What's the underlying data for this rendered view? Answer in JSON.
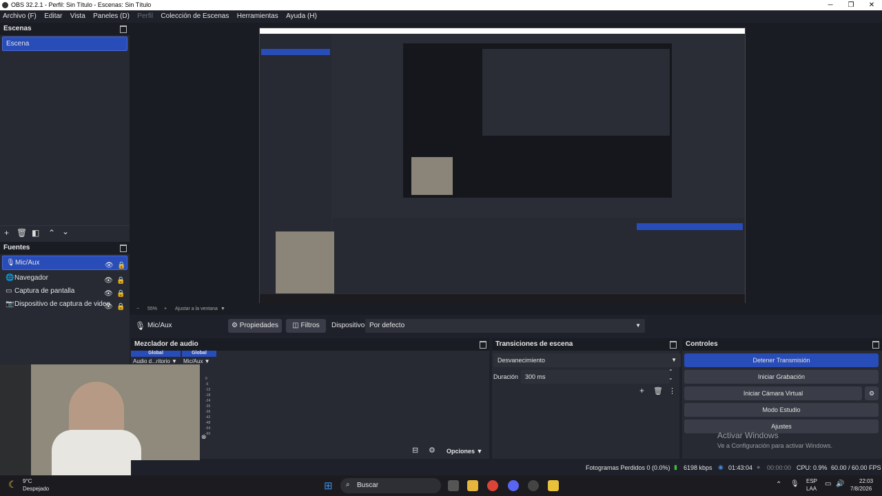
{
  "window": {
    "title": "OBS 32.2.1 - Perfil: Sin Título - Escenas: Sin Título",
    "min_glyph": "─",
    "max_glyph": "❐",
    "close_glyph": "✕"
  },
  "menu": [
    "Archivo (F)",
    "Editar",
    "Vista",
    "Paneles (D)",
    "Perfil",
    "Colección de Escenas",
    "Herramientas",
    "Ayuda (H)"
  ],
  "scenes": {
    "title": "Escenas",
    "items": [
      "Escena"
    ]
  },
  "sources": {
    "title": "Fuentes",
    "items": [
      "Mic/Aux",
      "Navegador",
      "Captura de pantalla",
      "Dispositivo de captura de video"
    ]
  },
  "preview_bar": {
    "zoom": "55%",
    "fit_label": "Ajustar a la ventana",
    "minus": "−",
    "plus": "+"
  },
  "source_toolbar": {
    "source": "Mic/Aux",
    "properties": "Propiedades",
    "filters": "Filtros",
    "device_label": "Dispositivo",
    "device_value": "Por defecto"
  },
  "mixer": {
    "title": "Mezclador de audio",
    "channels": [
      {
        "header": "Global",
        "name": "Audio d...ritorio"
      },
      {
        "header": "Global",
        "name": "Mic/Aux"
      }
    ],
    "scale": [
      "0",
      "-6",
      "-12",
      "-18",
      "-24",
      "-30",
      "-36",
      "-42",
      "-48",
      "-54",
      "-60"
    ],
    "options": "Opciones"
  },
  "transitions": {
    "title": "Transiciones de escena",
    "transition": "Desvanecimiento",
    "duration_label": "Duración",
    "duration_value": "300 ms"
  },
  "controls": {
    "title": "Controles",
    "buttons": [
      "Detener Transmisión",
      "Iniciar Grabación",
      "Iniciar Cámara Virtual",
      "Modo Estudio",
      "Ajustes"
    ]
  },
  "watermark": {
    "line1": "Activar Windows",
    "line2": "Ve a Configuración para activar Windows."
  },
  "status": {
    "dropped": "Fotogramas Perdidos 0 (0.0%)",
    "kbps": "6198 kbps",
    "stream_time": "01:43:04",
    "rec_time": "00:00:00",
    "cpu": "CPU: 0.9%",
    "fps": "60.00 / 60.00 FPS"
  },
  "taskbar": {
    "weather_temp": "9°C",
    "weather_desc": "Despejado",
    "search": "Buscar",
    "lang1": "ESP",
    "lang2": "LAA",
    "time": "22:03",
    "date": "7/8/2026"
  },
  "colors": {
    "accent": "#284cb8",
    "bg": "#1f212a",
    "panel": "#272a33"
  }
}
